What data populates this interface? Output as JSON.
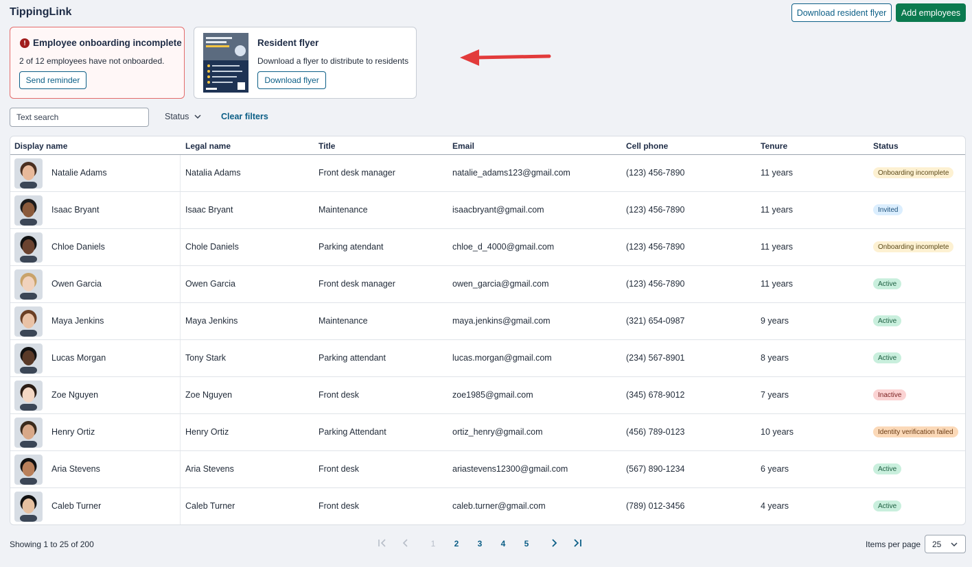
{
  "app": {
    "title": "TippingLink"
  },
  "header": {
    "download_flyer_label": "Download resident flyer",
    "add_employees_label": "Add employees"
  },
  "alert_card": {
    "title": "Employee onboarding incomplete",
    "message": "2 of 12 employees have not onboarded.",
    "button_label": "Send reminder"
  },
  "flyer_card": {
    "title": "Resident flyer",
    "message": "Download a flyer to distribute to residents",
    "button_label": "Download flyer"
  },
  "filters": {
    "search_placeholder": "Text search",
    "status_label": "Status",
    "clear_label": "Clear filters"
  },
  "table": {
    "columns": [
      "Display name",
      "Legal name",
      "Title",
      "Email",
      "Cell phone",
      "Tenure",
      "Status"
    ],
    "rows": [
      {
        "display": "Natalie Adams",
        "legal": "Natalia Adams",
        "title": "Front desk manager",
        "email": "natalie_adams123@gmail.com",
        "phone": "(123) 456-7890",
        "tenure": "11 years",
        "status": "Onboarding incomplete",
        "status_kind": "onboarding"
      },
      {
        "display": "Isaac Bryant",
        "legal": "Isaac Bryant",
        "title": "Maintenance",
        "email": "isaacbryant@gmail.com",
        "phone": "(123) 456-7890",
        "tenure": "11 years",
        "status": "Invited",
        "status_kind": "invited"
      },
      {
        "display": "Chloe Daniels",
        "legal": "Chole Daniels",
        "title": "Parking atendant",
        "email": "chloe_d_4000@gmail.com",
        "phone": "(123) 456-7890",
        "tenure": "11 years",
        "status": "Onboarding incomplete",
        "status_kind": "onboarding"
      },
      {
        "display": "Owen Garcia",
        "legal": "Owen Garcia",
        "title": "Front desk manager",
        "email": "owen_garcia@gmail.com",
        "phone": "(123) 456-7890",
        "tenure": "11 years",
        "status": "Active",
        "status_kind": "active"
      },
      {
        "display": "Maya Jenkins",
        "legal": "Maya Jenkins",
        "title": "Maintenance",
        "email": "maya.jenkins@gmail.com",
        "phone": "(321) 654-0987",
        "tenure": "9 years",
        "status": "Active",
        "status_kind": "active"
      },
      {
        "display": "Lucas Morgan",
        "legal": "Tony Stark",
        "title": "Parking attendant",
        "email": "lucas.morgan@gmail.com",
        "phone": "(234) 567-8901",
        "tenure": "8 years",
        "status": "Active",
        "status_kind": "active"
      },
      {
        "display": "Zoe Nguyen",
        "legal": "Zoe Nguyen",
        "title": "Front desk",
        "email": "zoe1985@gmail.com",
        "phone": "(345) 678-9012",
        "tenure": "7 years",
        "status": "Inactive",
        "status_kind": "inactive"
      },
      {
        "display": "Henry Ortiz",
        "legal": "Henry Ortiz",
        "title": "Parking Attendant",
        "email": "ortiz_henry@gmail.com",
        "phone": "(456) 789-0123",
        "tenure": "10 years",
        "status": "Identity verification failed",
        "status_kind": "failed"
      },
      {
        "display": "Aria Stevens",
        "legal": "Aria Stevens",
        "title": "Front desk",
        "email": "ariastevens12300@gmail.com",
        "phone": "(567) 890-1234",
        "tenure": "6 years",
        "status": "Active",
        "status_kind": "active"
      },
      {
        "display": "Caleb Turner",
        "legal": "Caleb Turner",
        "title": "Front desk",
        "email": "caleb.turner@gmail.com",
        "phone": "(789) 012-3456",
        "tenure": "4 years",
        "status": "Active",
        "status_kind": "active"
      }
    ]
  },
  "pagination": {
    "showing": "Showing 1 to 25  of 200",
    "pages": [
      "1",
      "2",
      "3",
      "4",
      "5"
    ],
    "current_page": "1",
    "items_per_page_label": "Items per page",
    "items_per_page_value": "25"
  },
  "colors": {
    "primary": "#0b7a4f",
    "link": "#0b5e86",
    "alert_border": "#e36b6b",
    "badge_onboarding": "#fdf1d2",
    "badge_invited": "#dbeefe",
    "badge_active": "#c9efdd",
    "badge_inactive": "#fbd3d3",
    "badge_failed": "#fbd9b8"
  }
}
